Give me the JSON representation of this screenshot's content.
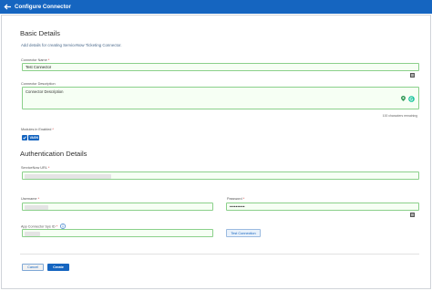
{
  "header": {
    "title": "Configure Connector"
  },
  "basic": {
    "title": "Basic Details",
    "subtitle": "Add details for creating ServiceNow Ticketing Connector.",
    "name_label": "Connector Name",
    "name_value": "Test Connector",
    "desc_label": "Connector Description",
    "desc_placeholder": "Connector Description",
    "desc_counter": "100 characters remaining",
    "enabled_label": "Modules in Enabled",
    "enabled_toggle": "VAGN"
  },
  "auth": {
    "title": "Authentication Details",
    "url_label": "ServiceNow URL",
    "username_label": "Username",
    "password_label": "Password",
    "password_value": "••••••••••",
    "app_id_label": "App Connector Sys ID",
    "test_button": "Test Connection"
  },
  "footer": {
    "cancel": "Cancel",
    "create": "Create"
  },
  "colors": {
    "primary": "#1565c0",
    "valid_border": "#8bd08b",
    "required": "#d32f2f"
  },
  "icons": [
    "back-arrow-icon",
    "list-icon",
    "location-pin-icon",
    "grammarly-icon",
    "info-icon",
    "check-icon",
    "eye-icon"
  ]
}
